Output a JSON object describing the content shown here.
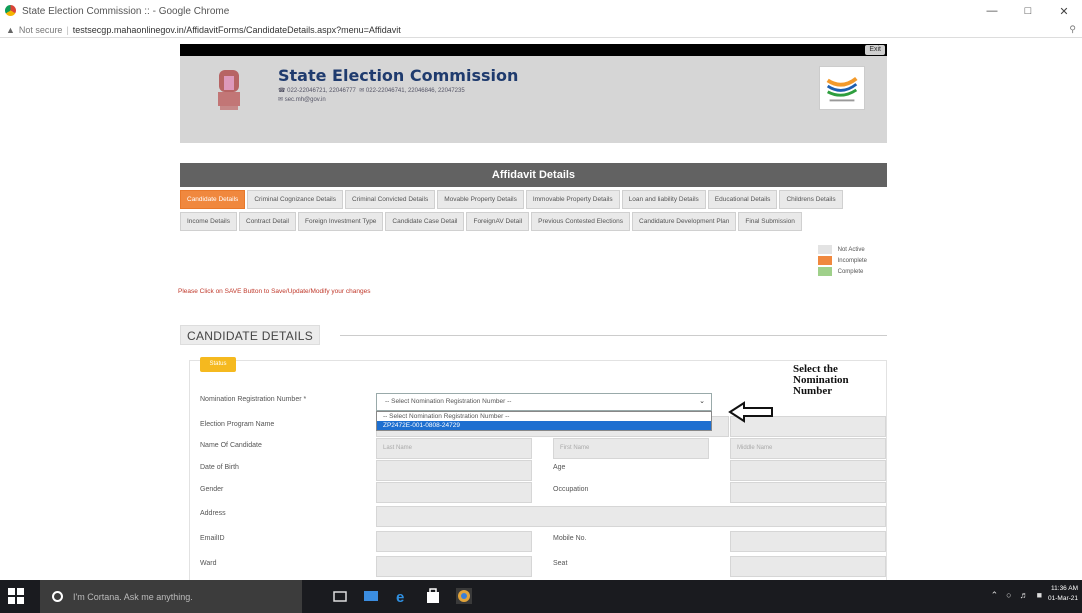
{
  "browser": {
    "window_title": "State Election Commission :: - Google Chrome",
    "not_secure": "Not secure",
    "url": "testsecgp.mahaonlinegov.in/AffidavitForms/CandidateDetails.aspx?menu=Affidavit"
  },
  "header": {
    "exit_label": "Exit",
    "title": "State Election Commission",
    "contact_phone": "022-22046721, 22046777",
    "contact_fax": "022-22046741, 22046846, 22047235",
    "contact_email": "sec.mh@gov.in"
  },
  "affidavit_title": "Affidavit Details",
  "tabs": [
    {
      "label": "Candidate Details",
      "active": true
    },
    {
      "label": "Criminal Cognizance Details",
      "active": false
    },
    {
      "label": "Criminal Convicted Details",
      "active": false
    },
    {
      "label": "Movable Property Details",
      "active": false
    },
    {
      "label": "Immovable Property Details",
      "active": false
    },
    {
      "label": "Loan and liability Details",
      "active": false
    },
    {
      "label": "Educational Details",
      "active": false
    },
    {
      "label": "Childrens Details",
      "active": false
    },
    {
      "label": "Income Details",
      "active": false
    },
    {
      "label": "Contract Detail",
      "active": false
    },
    {
      "label": "Foreign Investment Type",
      "active": false
    },
    {
      "label": "Candidate Case Detail",
      "active": false
    },
    {
      "label": "ForeignAV Detail",
      "active": false
    },
    {
      "label": "Previous Contested Elections",
      "active": false
    },
    {
      "label": "Candidature Development Plan",
      "active": false
    },
    {
      "label": "Final Submission",
      "active": false
    }
  ],
  "legend": {
    "not_active": "Not Active",
    "incomplete": "Incomplete",
    "complete": "Complete",
    "colors": {
      "not_active": "#e3e3e3",
      "incomplete": "#f0883e",
      "complete": "#9fd08a"
    }
  },
  "notice": "Please Click on SAVE Button to Save/Update/Modify your changes",
  "section_title": "CANDIDATE DETAILS",
  "status_badge": "Status",
  "form": {
    "nomination_label": "Nomination Registration Number *",
    "select_placeholder": "-- Select Nomination Registration Number --",
    "dropdown_options": [
      {
        "label": "-- Select Nomination Registration Number --",
        "selected": false
      },
      {
        "label": "ZP2472E-001-0808-24729",
        "selected": true
      }
    ],
    "election_program_label": "Election Program Name",
    "candidate_name_label": "Name Of Candidate",
    "last_name_placeholder": "Last Name",
    "first_name_placeholder": "First Name",
    "middle_name_placeholder": "Middle Name",
    "dob_label": "Date of Birth",
    "age_label": "Age",
    "gender_label": "Gender",
    "occupation_label": "Occupation",
    "address_label": "Address",
    "email_label": "EmailID",
    "mobile_label": "Mobile No.",
    "ward_label": "Ward",
    "seat_label": "Seat"
  },
  "annotation": {
    "line1": "Select the",
    "line2": "Nomination",
    "line3": "Number"
  },
  "taskbar": {
    "search_text": "I'm Cortana. Ask me anything.",
    "time": "11:36 AM",
    "date": "01-Mar-21"
  }
}
